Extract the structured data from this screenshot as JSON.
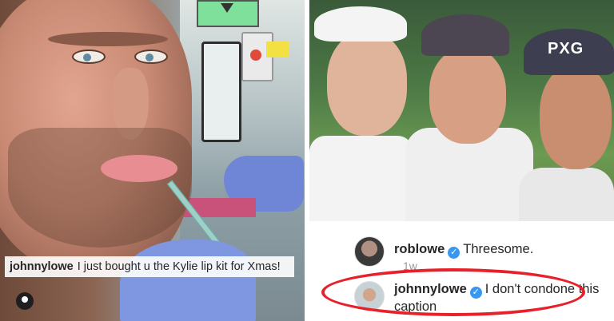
{
  "left_post": {
    "caption": {
      "username": "johnnylowe",
      "text": "I just bought u the Kylie lip kit for Xmas!"
    },
    "user_tag_icon": "person-tag-icon"
  },
  "right_post": {
    "photo": {
      "cap_logo": "PXG"
    },
    "comments": [
      {
        "username": "roblowe",
        "verified": true,
        "text": "Threesome."
      },
      {
        "username": "johnnylowe",
        "verified": true,
        "text": "I don't condone this caption"
      }
    ],
    "timestamp": "1w",
    "verified_icon": "verified-badge-icon"
  },
  "colors": {
    "highlight": "#e8202a",
    "verified": "#3897f0",
    "text": "#262626"
  }
}
